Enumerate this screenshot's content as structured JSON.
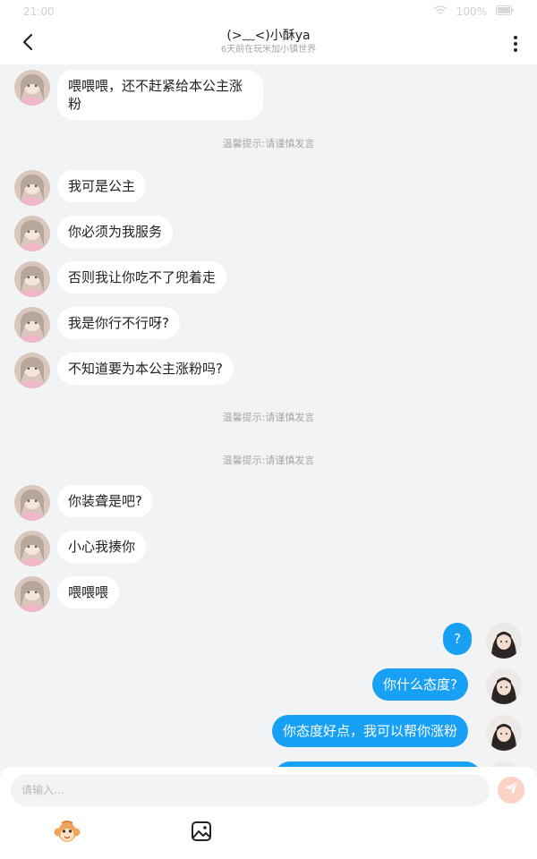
{
  "status_bar": {
    "time": "21:00",
    "battery": "100%"
  },
  "header": {
    "title": "(>﹏<)小酥ya",
    "subtitle": "6天前在玩米加小镇世界"
  },
  "messages": [
    {
      "side": "left",
      "text": "喂喂喂，还不赶紧给本公主涨粉"
    },
    {
      "type": "notice",
      "text": "温馨提示:请谨慎发言"
    },
    {
      "side": "left",
      "text": "我可是公主"
    },
    {
      "side": "left",
      "text": "你必须为我服务"
    },
    {
      "side": "left",
      "text": "否则我让你吃不了兜着走"
    },
    {
      "side": "left",
      "text": "我是你行不行呀?"
    },
    {
      "side": "left",
      "text": "不知道要为本公主涨粉吗?"
    },
    {
      "type": "notice",
      "text": "温馨提示:请谨慎发言"
    },
    {
      "type": "notice",
      "text": "温馨提示:请谨慎发言"
    },
    {
      "side": "left",
      "text": "你装聋是吧?"
    },
    {
      "side": "left",
      "text": "小心我揍你"
    },
    {
      "side": "left",
      "text": "喂喂喂"
    },
    {
      "side": "right",
      "text": "?"
    },
    {
      "side": "right",
      "text": "你什么态度?"
    },
    {
      "side": "right",
      "text": "你态度好点，我可以帮你涨粉"
    }
  ],
  "input": {
    "placeholder": "请输入..."
  },
  "icons": {
    "back": "back-arrow-icon",
    "more": "more-vertical-icon",
    "send": "send-paper-plane-icon",
    "emoji": "monkey-emoji-icon",
    "image": "image-icon"
  },
  "colors": {
    "accent": "#18a0f5",
    "background": "#f2f3f5",
    "bubble_left": "#ffffff",
    "send_button": "#fbd2c6"
  }
}
